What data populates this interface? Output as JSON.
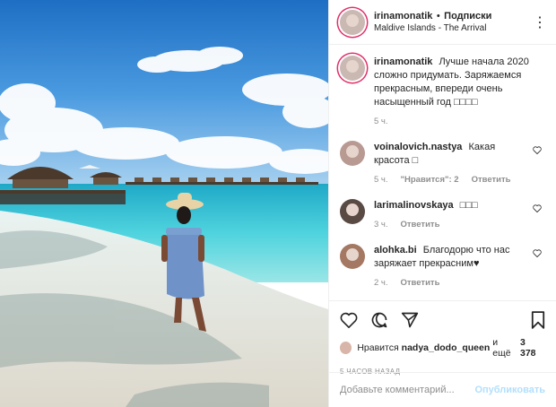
{
  "header": {
    "username": "irinamonatik",
    "separator": "•",
    "follow_label": "Подписки",
    "location": "Maldive Islands - The Arrival",
    "more": "⋮"
  },
  "caption": {
    "username": "irinamonatik",
    "text": "Лучше начала 2020 сложно придумать. Заряжаемся прекрасным, впереди очень насыщенный год □□□□",
    "time": "5 ч."
  },
  "comments": [
    {
      "username": "voinalovich.nastya",
      "text": "Какая красота □",
      "time": "5 ч.",
      "likes": "\"Нравится\": 2",
      "reply": "Ответить"
    },
    {
      "username": "larimalinovskaya",
      "text": "□□□",
      "time": "3 ч.",
      "reply": "Ответить"
    },
    {
      "username": "alohka.bi",
      "text": "Благодорю что нас заряжает прекрасним♥",
      "time": "2 ч.",
      "reply": "Ответить"
    }
  ],
  "likes": {
    "prefix": "Нравится",
    "user": "nadya_dodo_queen",
    "suffix": "и ещё",
    "count": "3 378"
  },
  "timestamp": "5 ЧАСОВ НАЗАД",
  "add_comment": {
    "placeholder": "Добавьте комментарий...",
    "publish": "Опубликовать"
  },
  "icons": [
    "heart-icon",
    "comment-icon",
    "share-icon",
    "bookmark-icon"
  ],
  "colors": {
    "sky": "#3b8fd6",
    "sea": "#33c6d8",
    "sand": "#ece8df",
    "link_disabled": "#b2dffc"
  }
}
